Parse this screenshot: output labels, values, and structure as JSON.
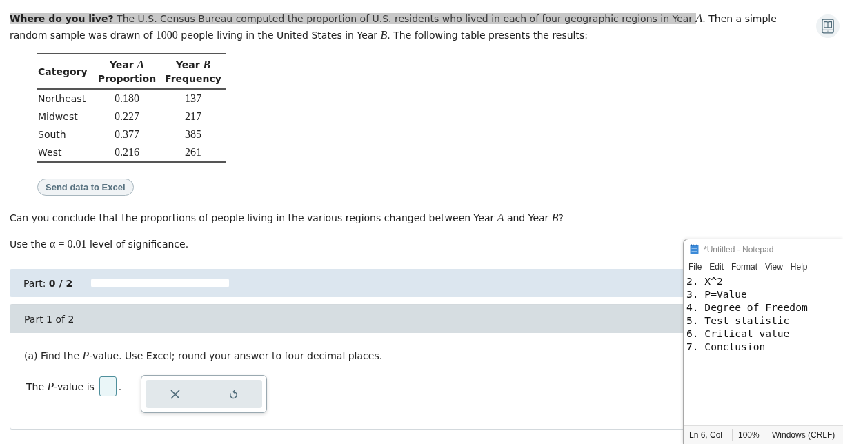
{
  "intro": {
    "segments": [
      {
        "kind": "text",
        "text": "**Where do you live?** The U.S. Census Bureau computed the proportion of U.S. residents who lived in each of four geographic regions in Year ",
        "highlighted": true
      },
      {
        "kind": "var",
        "text": "A",
        "highlighted": false
      },
      {
        "kind": "text",
        "text": ". Then a simple random sample was drawn of ",
        "highlighted": false
      },
      {
        "kind": "num",
        "text": "1000",
        "highlighted": false
      },
      {
        "kind": "text",
        "text": " people living in the United States in Year ",
        "highlighted": false
      },
      {
        "kind": "var",
        "text": "B",
        "highlighted": false
      },
      {
        "kind": "text",
        "text": ". The following table presents the results:",
        "highlighted": false
      }
    ]
  },
  "table": {
    "columns": [
      {
        "title": "Category",
        "kind": "text"
      },
      {
        "title": "Year *A*",
        "subtitle": "Proportion",
        "kind": "num"
      },
      {
        "title": "Year *B*",
        "subtitle": "Frequency",
        "kind": "num"
      }
    ],
    "rows": [
      [
        "Northeast",
        "0.180",
        "137"
      ],
      [
        "Midwest",
        "0.227",
        "217"
      ],
      [
        "South",
        "0.377",
        "385"
      ],
      [
        "West",
        "0.216",
        "261"
      ]
    ]
  },
  "send_button": "Send data to Excel",
  "question": [
    {
      "kind": "text",
      "text": "Can you conclude that the proportions of people living in the various regions changed between Year "
    },
    {
      "kind": "var",
      "text": "A"
    },
    {
      "kind": "text",
      "text": " and Year "
    },
    {
      "kind": "var",
      "text": "B"
    },
    {
      "kind": "text",
      "text": "?"
    }
  ],
  "significance": [
    {
      "kind": "text",
      "text": "Use the "
    },
    {
      "kind": "num",
      "text": "α = 0.01"
    },
    {
      "kind": "text",
      "text": " level of significance."
    }
  ],
  "progress": {
    "label": "Part: **0 / 2**",
    "level": 0
  },
  "part": {
    "title": "Part 1 of 2",
    "prompt": [
      {
        "kind": "text",
        "text": "(a) Find the "
      },
      {
        "kind": "var",
        "text": "P"
      },
      {
        "kind": "text",
        "text": "-value. Use Excel; round your answer to four decimal places."
      }
    ],
    "answer": {
      "label": [
        {
          "kind": "text",
          "text": "The "
        },
        {
          "kind": "var",
          "text": "P"
        },
        {
          "kind": "text",
          "text": "-value is"
        }
      ],
      "after": "."
    }
  },
  "notepad": {
    "title": "*Untitled - Notepad",
    "menu": [
      "File",
      "Edit",
      "Format",
      "View",
      "Help"
    ],
    "lines": [
      "2. X^2",
      "3. P=Value",
      "4. Degree of Freedom",
      "5. Test statistic",
      "6. Critical value",
      "7. Conclusion"
    ],
    "status": [
      "Ln 6, Col",
      "100%",
      "Windows (CRLF)"
    ]
  }
}
